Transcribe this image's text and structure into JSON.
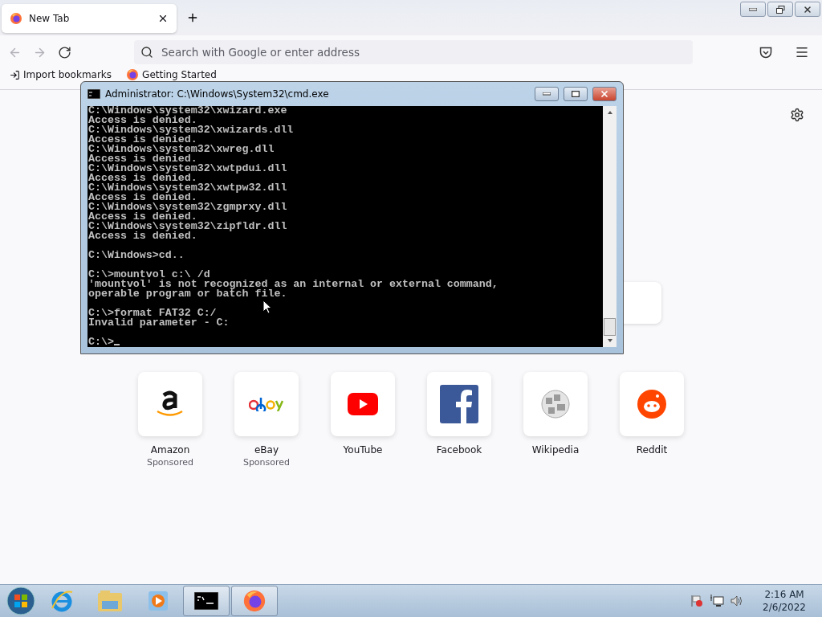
{
  "browser": {
    "tabs": [
      {
        "title": "New Tab",
        "selected": true
      }
    ],
    "address_bar": {
      "placeholder": "Search with Google or enter address"
    },
    "bookmarks": [
      {
        "kind": "import",
        "label": "Import bookmarks"
      },
      {
        "kind": "firefox",
        "label": "Getting Started"
      }
    ],
    "shortcuts": [
      {
        "kind": "amazon",
        "name": "Amazon",
        "sublabel": "Sponsored"
      },
      {
        "kind": "ebay",
        "name": "eBay",
        "sublabel": "Sponsored"
      },
      {
        "kind": "youtube",
        "name": "YouTube"
      },
      {
        "kind": "facebook",
        "name": "Facebook"
      },
      {
        "kind": "wikipedia",
        "name": "Wikipedia"
      },
      {
        "kind": "reddit",
        "name": "Reddit"
      }
    ]
  },
  "console_window": {
    "title": "Administrator: C:\\Windows\\System32\\cmd.exe",
    "blocks": [
      [
        "C:\\Windows\\system32\\xwizard.exe",
        "Access is denied.",
        "C:\\Windows\\system32\\xwizards.dll",
        "Access is denied.",
        "C:\\Windows\\system32\\xwreg.dll",
        "Access is denied.",
        "C:\\Windows\\system32\\xwtpdui.dll",
        "Access is denied.",
        "C:\\Windows\\system32\\xwtpw32.dll",
        "Access is denied.",
        "C:\\Windows\\system32\\zgmprxy.dll",
        "Access is denied.",
        "C:\\Windows\\system32\\zipfldr.dll",
        "Access is denied."
      ],
      [
        "C:\\Windows>cd.."
      ],
      [
        "C:\\>mountvol c:\\ /d",
        "'mountvol' is not recognized as an internal or external command,",
        "operable program or batch file."
      ],
      [
        "C:\\>format FAT32 C:/",
        "Invalid parameter - C:"
      ]
    ],
    "prompt": "C:\\>"
  },
  "taskbar": {
    "apps": [
      {
        "kind": "ie",
        "running": false
      },
      {
        "kind": "explorer",
        "running": false
      },
      {
        "kind": "media",
        "running": false
      },
      {
        "kind": "cmd",
        "running": true
      },
      {
        "kind": "firefox",
        "running": true
      }
    ],
    "clock": {
      "time": "2:16 AM",
      "date": "2/6/2022"
    }
  }
}
